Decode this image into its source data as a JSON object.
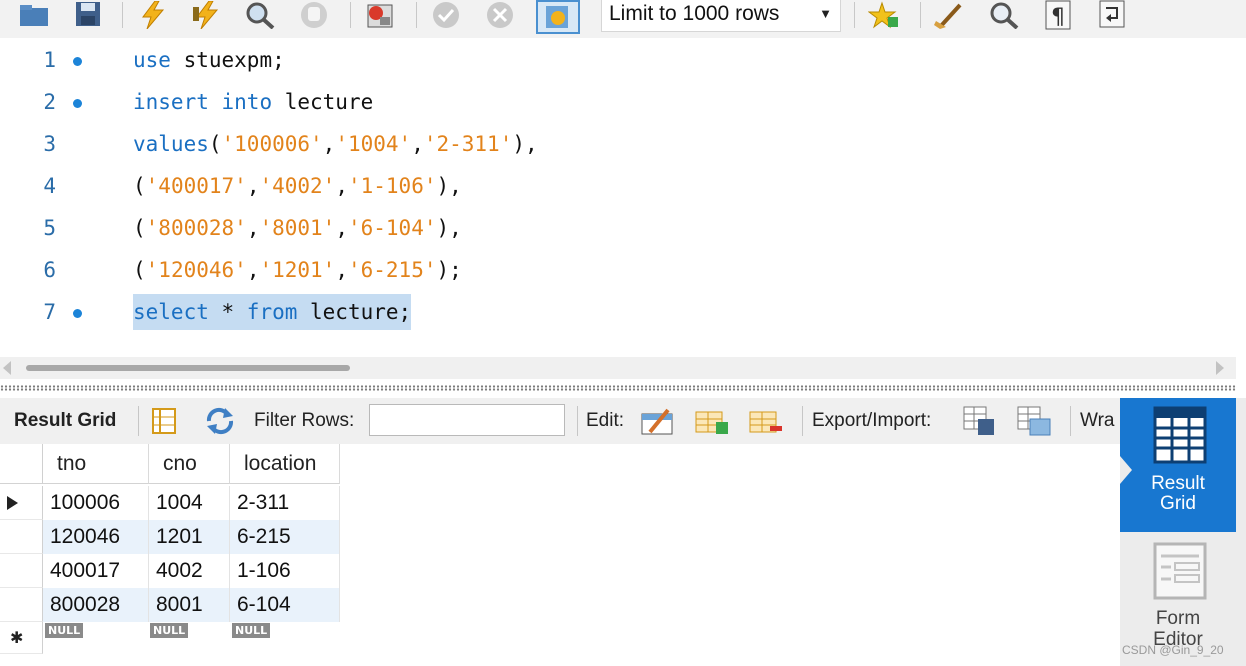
{
  "toolbar": {
    "limit_select_value": "Limit to 1000 rows",
    "icons": [
      "open-folder-icon",
      "save-icon",
      "execute-icon",
      "execute-current-icon",
      "explain-icon",
      "stop-icon",
      "toggle-error-icon",
      "commit-icon",
      "rollback-icon",
      "autocommit-icon",
      "limit-dropdown",
      "add-snippet-icon",
      "beautify-icon",
      "find-icon",
      "invisible-chars-icon",
      "wrap-icon"
    ]
  },
  "editor": {
    "line_numbers": [
      "1",
      "2",
      "3",
      "4",
      "5",
      "6",
      "7"
    ],
    "line1": {
      "kw_use": "use",
      "rest": " stuexpm;"
    },
    "line2": {
      "kw_insert": "insert",
      "sp1": " ",
      "kw_into": "into",
      "rest": " lecture"
    },
    "line3": {
      "kw_values": "values",
      "p1": "(",
      "s1": "'100006'",
      "c1": ",",
      "s2": "'1004'",
      "c2": ",",
      "s3": "'2-311'",
      "p2": "),"
    },
    "line4": {
      "p1": "(",
      "s1": "'400017'",
      "c1": ",",
      "s2": "'4002'",
      "c2": ",",
      "s3": "'1-106'",
      "p2": "),"
    },
    "line5": {
      "p1": "(",
      "s1": "'800028'",
      "c1": ",",
      "s2": "'8001'",
      "c2": ",",
      "s3": "'6-104'",
      "p2": "),"
    },
    "line6": {
      "p1": "(",
      "s1": "'120046'",
      "c1": ",",
      "s2": "'1201'",
      "c2": ",",
      "s3": "'6-215'",
      "p2": ");"
    },
    "line7": {
      "kw_select": "select",
      "star": " * ",
      "kw_from": "from",
      "rest": " lecture;"
    }
  },
  "result_toolbar": {
    "result_grid_label": "Result Grid",
    "filter_rows_label": "Filter Rows:",
    "filter_value": "",
    "edit_label": "Edit:",
    "export_import_label": "Export/Import:",
    "wrap_label": "Wra"
  },
  "grid": {
    "columns": [
      "tno",
      "cno",
      "location"
    ],
    "rows": [
      [
        "100006",
        "1004",
        "2-311"
      ],
      [
        "120046",
        "1201",
        "6-215"
      ],
      [
        "400017",
        "4002",
        "1-106"
      ],
      [
        "800028",
        "8001",
        "6-104"
      ]
    ],
    "null_label": "NULL"
  },
  "side_panel": {
    "result_grid_line1": "Result",
    "result_grid_line2": "Grid",
    "form_editor_line1": "Form",
    "form_editor_line2": "Editor"
  },
  "watermark": "CSDN @Gin_9_20",
  "colors": {
    "keyword": "#1a6fc2",
    "string": "#e2831b",
    "accent": "#1877d0",
    "selection": "#c5dcf2"
  }
}
